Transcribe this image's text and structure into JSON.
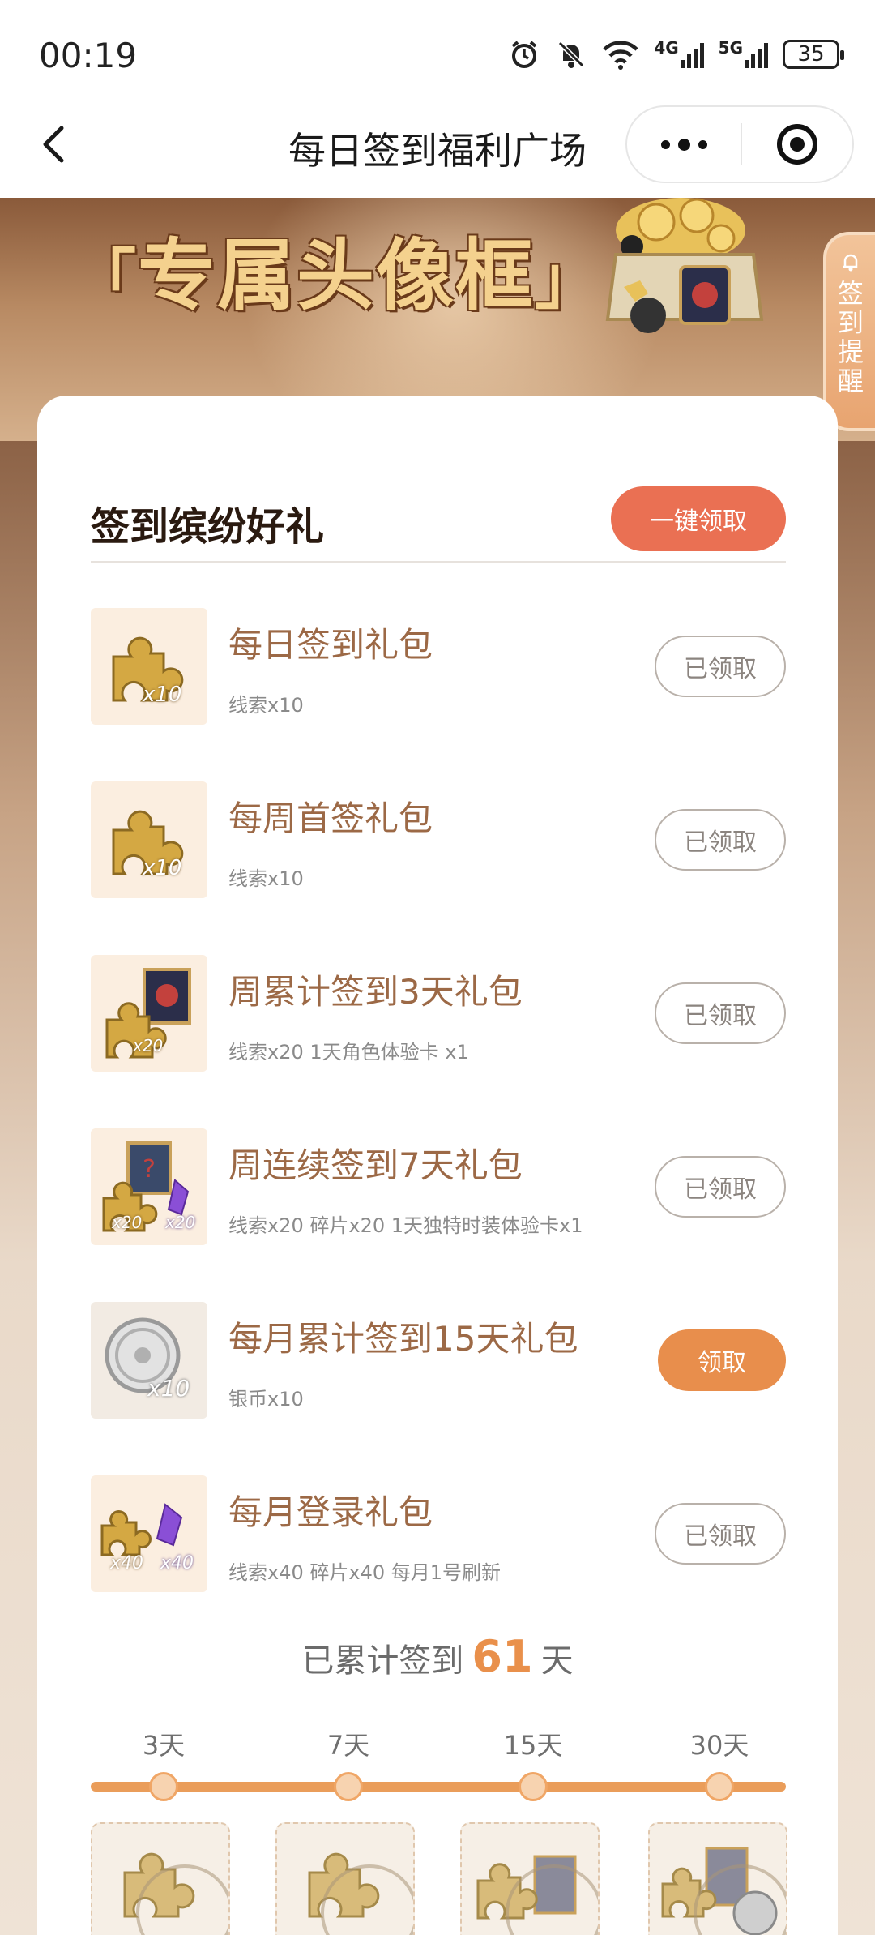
{
  "status": {
    "time": "00:19",
    "network_4g": "4G",
    "network_5g": "5G",
    "battery": "35"
  },
  "nav": {
    "title": "每日签到福利广场"
  },
  "banner": {
    "title": "专属头像框",
    "bracket_open": "「",
    "bracket_close": "」"
  },
  "remind_tab": {
    "chars": [
      "签",
      "到",
      "提",
      "醒"
    ]
  },
  "card": {
    "title": "签到缤纷好礼",
    "claim_all_label": "一键领取"
  },
  "gifts": [
    {
      "name": "每日签到礼包",
      "desc": "线索x10",
      "button": "已领取",
      "state": "claimed",
      "badge": "x10"
    },
    {
      "name": "每周首签礼包",
      "desc": "线索x10",
      "button": "已领取",
      "state": "claimed",
      "badge": "x10"
    },
    {
      "name": "周累计签到3天礼包",
      "desc": "线索x20 1天角色体验卡 x1",
      "button": "已领取",
      "state": "claimed",
      "badge": "x20"
    },
    {
      "name": "周连续签到7天礼包",
      "desc": "线索x20 碎片x20 1天独特时装体验卡x1",
      "button": "已领取",
      "state": "claimed",
      "badge": "x20"
    },
    {
      "name": "每月累计签到15天礼包",
      "desc": "银币x10",
      "button": "领取",
      "state": "active",
      "badge": "x10"
    },
    {
      "name": "每月登录礼包",
      "desc": "线索x40 碎片x40 每月1号刷新",
      "button": "已领取",
      "state": "claimed",
      "badge": "x40"
    }
  ],
  "summary": {
    "prefix": "已累计签到",
    "days": "61",
    "suffix": "天"
  },
  "milestones": [
    {
      "label": "3天"
    },
    {
      "label": "7天"
    },
    {
      "label": "15天"
    },
    {
      "label": "30天"
    }
  ],
  "colors": {
    "accent_orange": "#e88e4c",
    "claim_all_red": "#ea7053",
    "gift_name_brown": "#9c6946"
  }
}
